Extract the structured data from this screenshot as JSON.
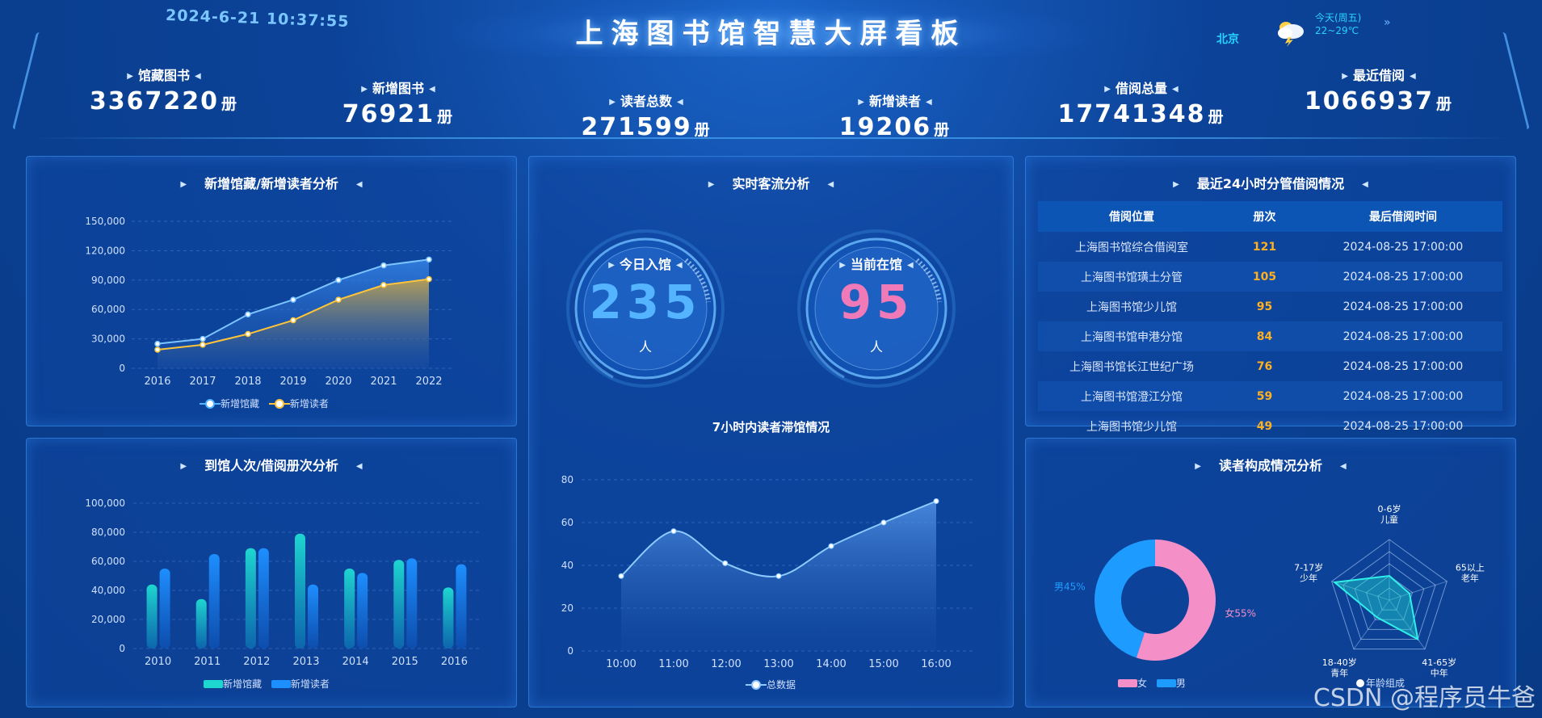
{
  "header": {
    "datetime": "2024-6-21 10:37:55",
    "title": "上海图书馆智慧大屏看板",
    "city": "北京",
    "weather_icon": "thunderstorm-icon",
    "weather_day": "今天(周五)",
    "weather_temp": "22~29℃",
    "more_icon": "chevron-right-icon",
    "more_symbol": "»"
  },
  "stats": [
    {
      "label": "馆藏图书",
      "value": "3367220",
      "unit": "册"
    },
    {
      "label": "新增图书",
      "value": "76921",
      "unit": "册"
    },
    {
      "label": "读者总数",
      "value": "271599",
      "unit": "册"
    },
    {
      "label": "新增读者",
      "value": "19206",
      "unit": "册"
    },
    {
      "label": "借阅总量",
      "value": "17741348",
      "unit": "册"
    },
    {
      "label": "最近借阅",
      "value": "1066937",
      "unit": "册"
    }
  ],
  "panels": {
    "p1_title": "新增馆藏/新增读者分析",
    "p2_title": "到馆人次/借阅册次分析",
    "p3_title": "实时客流分析",
    "p4_title": "最近24小时分管借阅情况",
    "p5_title": "读者构成情况分析"
  },
  "gauges": {
    "today_label": "今日入馆",
    "today_value": "235",
    "today_unit": "人",
    "current_label": "当前在馆",
    "current_value": "95",
    "current_unit": "人"
  },
  "borrow_table": {
    "headers": [
      "借阅位置",
      "册次",
      "最后借阅时间"
    ],
    "rows": [
      [
        "上海图书馆综合借阅室",
        "121",
        "2024-08-25 17:00:00"
      ],
      [
        "上海图书馆璜土分管",
        "105",
        "2024-08-25 17:00:00"
      ],
      [
        "上海图书馆少儿馆",
        "95",
        "2024-08-25 17:00:00"
      ],
      [
        "上海图书馆申港分馆",
        "84",
        "2024-08-25 17:00:00"
      ],
      [
        "上海图书馆长江世纪广场",
        "76",
        "2024-08-25 17:00:00"
      ],
      [
        "上海图书馆澄江分馆",
        "59",
        "2024-08-25 17:00:00"
      ],
      [
        "上海图书馆少儿馆",
        "49",
        "2024-08-25 17:00:00"
      ]
    ]
  },
  "colors": {
    "accent": "#55b4ff",
    "gold": "#ffc43a",
    "teal": "#1ed6d0",
    "pink": "#f07ab8",
    "count": "#ffb020"
  },
  "watermark": "CSDN @程序员牛爸",
  "chart_data": [
    {
      "type": "area",
      "categories": [
        "2016",
        "2017",
        "2018",
        "2019",
        "2020",
        "2021",
        "2022"
      ],
      "series": [
        {
          "name": "新增馆藏",
          "values": [
            25000,
            30000,
            55000,
            70000,
            90000,
            105000,
            111000
          ]
        },
        {
          "name": "新增读者",
          "values": [
            19000,
            24000,
            35000,
            49000,
            70000,
            85000,
            91000
          ]
        }
      ],
      "yticks": [
        "0",
        "30,000",
        "60,000",
        "90,000",
        "120,000",
        "150,000"
      ],
      "ylim": [
        0,
        150000
      ],
      "grid": true,
      "legend": "bottom"
    },
    {
      "type": "bar",
      "categories": [
        "2010",
        "2011",
        "2012",
        "2013",
        "2014",
        "2015",
        "2016"
      ],
      "series": [
        {
          "name": "新增馆藏",
          "values": [
            44000,
            34000,
            69000,
            79000,
            55000,
            61000,
            42000
          ]
        },
        {
          "name": "新增读者",
          "values": [
            55000,
            65000,
            69000,
            44000,
            52000,
            62000,
            58000
          ]
        }
      ],
      "yticks": [
        "0",
        "20,000",
        "40,000",
        "60,000",
        "80,000",
        "100,000"
      ],
      "ylim": [
        0,
        100000
      ],
      "grid": true,
      "legend": "bottom"
    },
    {
      "type": "area",
      "title": "7小时内读者滞馆情况",
      "categories": [
        "10:00",
        "11:00",
        "12:00",
        "13:00",
        "14:00",
        "15:00",
        "16:00"
      ],
      "x": [
        0,
        1,
        2,
        3,
        4,
        5,
        6
      ],
      "x_points": [
        0,
        1,
        1.98,
        3,
        4,
        5,
        6
      ],
      "values": [
        35,
        56,
        41,
        35,
        49,
        60,
        70
      ],
      "series": [
        {
          "name": "总数据",
          "values": [
            35,
            56,
            41,
            35,
            49,
            60,
            70
          ]
        }
      ],
      "yticks": [
        "0",
        "20",
        "40",
        "60",
        "80"
      ],
      "ylim": [
        0,
        80
      ],
      "grid": true,
      "legend": "bottom"
    },
    {
      "type": "pie",
      "slices": [
        {
          "name": "女",
          "value": 55,
          "label": "女55%"
        },
        {
          "name": "男",
          "value": 45,
          "label": "男45%"
        }
      ],
      "legend": "bottom"
    },
    {
      "type": "radar",
      "indicators": [
        [
          "0-6岁",
          "儿童"
        ],
        [
          "65以上",
          "老年"
        ],
        [
          "41-65岁",
          "中年"
        ],
        [
          "18-40岁",
          "青年"
        ],
        [
          "7-17岁",
          "少年"
        ]
      ],
      "values": [
        0.4,
        0.35,
        0.8,
        0.35,
        0.95
      ],
      "series": [
        {
          "name": "年龄组成"
        }
      ],
      "legend": "bottom"
    }
  ]
}
